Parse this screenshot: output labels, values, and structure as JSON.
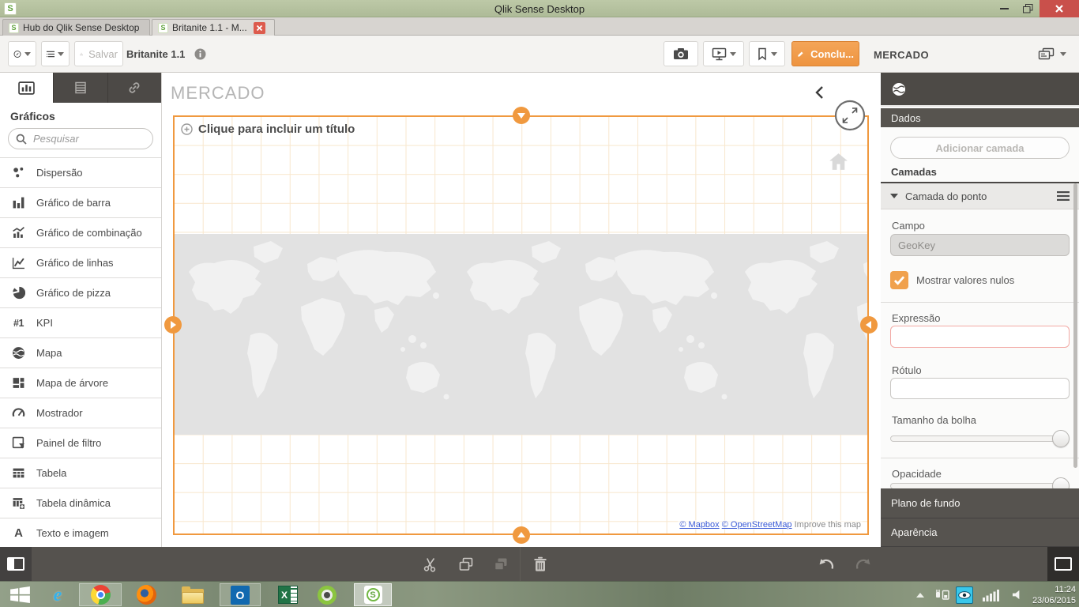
{
  "window": {
    "title": "Qlik Sense Desktop",
    "tabs": [
      {
        "label": "Hub do Qlik Sense Desktop"
      },
      {
        "label": "Britanite 1.1 - M..."
      }
    ]
  },
  "toolbar": {
    "save_label": "Salvar",
    "app_title": "Britanite 1.1",
    "done_label": "Conclu...",
    "sheet_label": "MERCADO"
  },
  "sidebar": {
    "title": "Gráficos",
    "search_placeholder": "Pesquisar",
    "items": [
      {
        "label": "Dispersão",
        "icon": "scatter-icon"
      },
      {
        "label": "Gráfico de barra",
        "icon": "bar-chart-icon"
      },
      {
        "label": "Gráfico de combinação",
        "icon": "combo-chart-icon"
      },
      {
        "label": "Gráfico de linhas",
        "icon": "line-chart-icon"
      },
      {
        "label": "Gráfico de pizza",
        "icon": "pie-chart-icon"
      },
      {
        "label": "KPI",
        "icon": "kpi-icon",
        "glyph": "#1"
      },
      {
        "label": "Mapa",
        "icon": "map-icon"
      },
      {
        "label": "Mapa de árvore",
        "icon": "treemap-icon"
      },
      {
        "label": "Mostrador",
        "icon": "gauge-icon"
      },
      {
        "label": "Painel de filtro",
        "icon": "filter-pane-icon"
      },
      {
        "label": "Tabela",
        "icon": "table-icon"
      },
      {
        "label": "Tabela dinâmica",
        "icon": "pivot-table-icon"
      },
      {
        "label": "Texto e imagem",
        "icon": "text-image-icon",
        "glyph": "A"
      }
    ]
  },
  "canvas": {
    "sheet_title": "MERCADO",
    "widget_title_placeholder": "Clique para incluir um título",
    "attribution": {
      "mapbox": "© Mapbox",
      "osm": "© OpenStreetMap",
      "improve": "Improve this map"
    }
  },
  "panel": {
    "data_section": "Dados",
    "add_layer_button": "Adicionar camada",
    "layers_label": "Camadas",
    "layer_name": "Camada do ponto",
    "field_label": "Campo",
    "field_value": "GeoKey",
    "show_nulls_label": "Mostrar valores nulos",
    "expression_label": "Expressão",
    "label_label": "Rótulo",
    "bubble_size_label": "Tamanho da bolha",
    "opacity_label": "Opacidade",
    "background_section": "Plano de fundo",
    "appearance_section": "Aparência"
  },
  "taskbar": {
    "time": "11:24",
    "date": "23/06/2015",
    "icons": [
      "windows-start",
      "internet-explorer",
      "chrome",
      "firefox",
      "file-explorer",
      "outlook",
      "excel",
      "qlikview",
      "qlik-sense"
    ],
    "glyphs": {
      "ie": "e",
      "outlook": "O",
      "excel": "X",
      "qlik": "S"
    }
  },
  "colors": {
    "accent_orange": "#f0993f",
    "titlebar_green": "#b6c2a0",
    "close_red": "#c9504b",
    "dark_ui": "#4d4a46",
    "checkbox_orange": "#f0a14d",
    "error_border": "#f2a9a4",
    "link_blue": "#3b5bd6"
  }
}
